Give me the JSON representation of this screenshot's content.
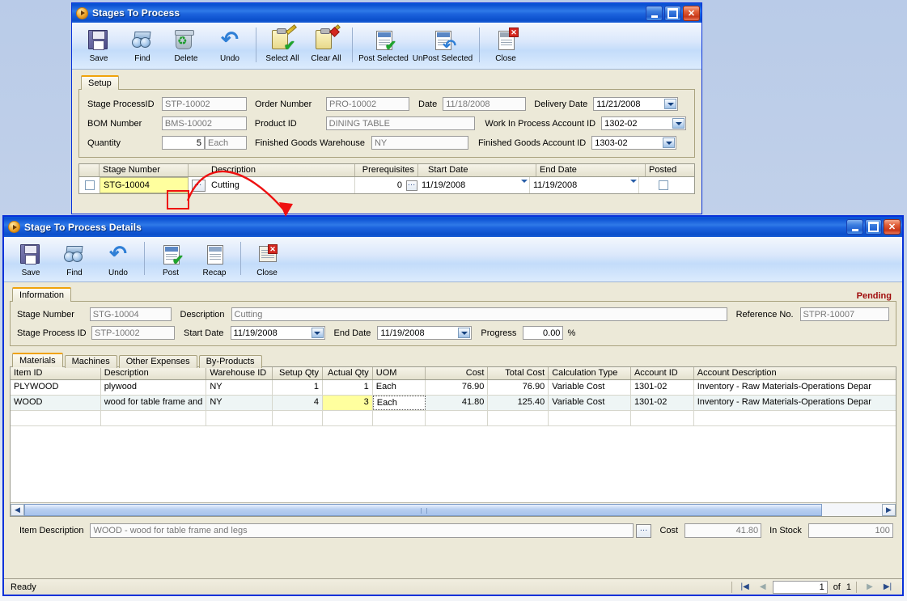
{
  "desktop": {
    "bg": "#c3d2ea"
  },
  "window1": {
    "title": "Stages To Process",
    "toolbar": [
      {
        "label": "Save",
        "icon": "save-icon"
      },
      {
        "label": "Find",
        "icon": "find-binoculars-icon"
      },
      {
        "label": "Delete",
        "icon": "delete-recycle-icon"
      },
      {
        "label": "Undo",
        "icon": "undo-arrow-icon"
      },
      {
        "label": "Select All",
        "icon": "select-all-clipboard-icon"
      },
      {
        "label": "Clear All",
        "icon": "clear-all-clipboard-icon"
      },
      {
        "label": "Post Selected",
        "icon": "post-documents-icon"
      },
      {
        "label": "UnPost Selected",
        "icon": "unpost-documents-icon"
      },
      {
        "label": "Close",
        "icon": "close-document-icon"
      }
    ],
    "tabs": [
      {
        "label": "Setup",
        "active": true
      }
    ],
    "fields": {
      "stage_process_id_label": "Stage ProcessID",
      "stage_process_id_value": "STP-10002",
      "order_number_label": "Order Number",
      "order_number_value": "PRO-10002",
      "date_label": "Date",
      "date_value": "11/18/2008",
      "delivery_date_label": "Delivery Date",
      "delivery_date_value": "11/21/2008",
      "bom_number_label": "BOM Number",
      "bom_number_value": "BMS-10002",
      "product_id_label": "Product ID",
      "product_id_value": "DINING TABLE",
      "wip_account_label": "Work In Process Account ID",
      "wip_account_value": "1302-02",
      "quantity_label": "Quantity",
      "quantity_value": "5",
      "quantity_uom": "Each",
      "fg_warehouse_label": "Finished Goods Warehouse",
      "fg_warehouse_value": "NY",
      "fg_account_label": "Finished Goods Account ID",
      "fg_account_value": "1303-02"
    },
    "grid": {
      "columns": [
        "",
        "Stage Number",
        "",
        "Description",
        "Prerequisites",
        "",
        "Start Date",
        "End Date",
        "Posted"
      ],
      "rows": [
        {
          "checked": false,
          "stage_number": "STG-10004",
          "description": "Cutting",
          "prerequisites": "0",
          "start_date": "11/19/2008",
          "end_date": "11/19/2008",
          "posted": false
        }
      ]
    }
  },
  "window2": {
    "title": "Stage To Process Details",
    "status_label": "Pending",
    "toolbar": [
      {
        "label": "Save",
        "icon": "save-icon"
      },
      {
        "label": "Find",
        "icon": "find-binoculars-icon"
      },
      {
        "label": "Undo",
        "icon": "undo-arrow-icon"
      },
      {
        "label": "Post",
        "icon": "post-documents-icon"
      },
      {
        "label": "Recap",
        "icon": "recap-documents-icon"
      },
      {
        "label": "Close",
        "icon": "close-document-icon"
      }
    ],
    "tabs": [
      {
        "label": "Information",
        "active": true
      }
    ],
    "fields": {
      "stage_number_label": "Stage Number",
      "stage_number_value": "STG-10004",
      "description_label": "Description",
      "description_value": "Cutting",
      "reference_no_label": "Reference No.",
      "reference_no_value": "STPR-10007",
      "stage_process_id_label": "Stage Process ID",
      "stage_process_id_value": "STP-10002",
      "start_date_label": "Start Date",
      "start_date_value": "11/19/2008",
      "end_date_label": "End Date",
      "end_date_value": "11/19/2008",
      "progress_label": "Progress",
      "progress_value": "0.00",
      "progress_unit": "%"
    },
    "detail_tabs": [
      {
        "label": "Materials",
        "active": true
      },
      {
        "label": "Machines",
        "active": false
      },
      {
        "label": "Other Expenses",
        "active": false
      },
      {
        "label": "By-Products",
        "active": false
      }
    ],
    "grid": {
      "columns": [
        "Item ID",
        "Description",
        "Warehouse ID",
        "Setup Qty",
        "Actual Qty",
        "UOM",
        "Cost",
        "Total Cost",
        "Calculation Type",
        "Account ID",
        "Account Description"
      ],
      "rows": [
        {
          "item_id": "PLYWOOD",
          "description": "plywood",
          "warehouse_id": "NY",
          "setup_qty": "1",
          "actual_qty": "1",
          "uom": "Each",
          "cost": "76.90",
          "total_cost": "76.90",
          "calculation_type": "Variable Cost",
          "account_id": "1301-02",
          "account_description": "Inventory - Raw Materials-Operations Depar"
        },
        {
          "item_id": "WOOD",
          "description": "wood for table frame and",
          "warehouse_id": "NY",
          "setup_qty": "4",
          "actual_qty": "3",
          "uom": "Each",
          "cost": "41.80",
          "total_cost": "125.40",
          "calculation_type": "Variable Cost",
          "account_id": "1301-02",
          "account_description": "Inventory - Raw Materials-Operations Depar"
        }
      ]
    },
    "footer": {
      "item_description_label": "Item Description",
      "item_description_value": "WOOD - wood for table frame and legs",
      "cost_label": "Cost",
      "cost_value": "41.80",
      "in_stock_label": "In Stock",
      "in_stock_value": "100"
    },
    "statusbar": {
      "status_text": "Ready",
      "page_current": "1",
      "page_of_label": "of",
      "page_total": "1"
    }
  },
  "annotation": {
    "color": "#ee1111"
  }
}
